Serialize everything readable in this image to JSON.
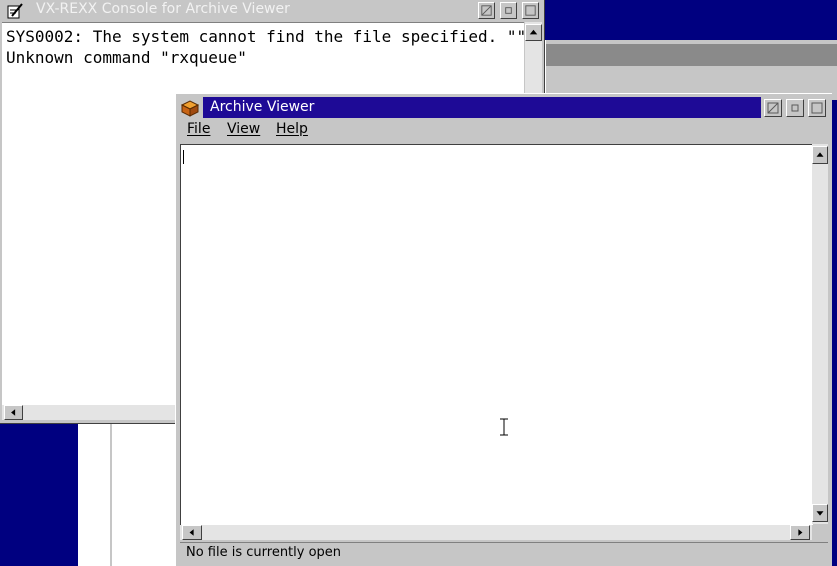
{
  "console": {
    "title": "VX-REXX Console for Archive Viewer",
    "lines": [
      "SYS0002: The system cannot find the file specified. \"\"",
      "Unknown command \"rxqueue\""
    ]
  },
  "viewer": {
    "title": "Archive Viewer",
    "menu": [
      {
        "label": "File"
      },
      {
        "label": "View"
      },
      {
        "label": "Help"
      }
    ],
    "status": "No file is currently open"
  },
  "icons": {
    "console": "notepad-pencil-icon",
    "viewer": "archive-box-icon"
  },
  "colors": {
    "active_title": "#1e0a96",
    "inactive_title": "#c6c6c6",
    "window_face": "#c6c6c6",
    "desktop": "#000080"
  }
}
